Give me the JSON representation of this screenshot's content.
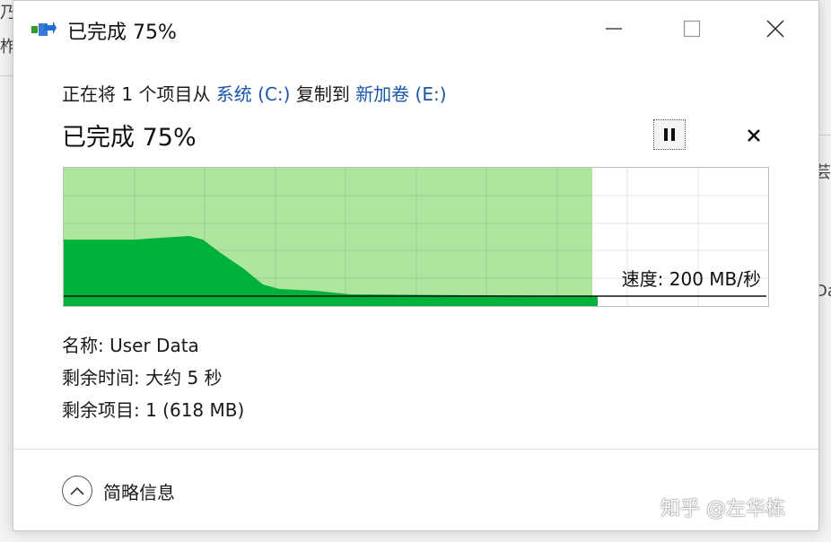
{
  "window": {
    "title": "已完成 75%"
  },
  "copy_line": {
    "prefix": "正在将 1 个项目从 ",
    "source": "系统 (C:)",
    "middle": " 复制到 ",
    "destination": "新加卷 (E:)"
  },
  "status": {
    "text": "已完成 75%",
    "percent": 75
  },
  "graph": {
    "speed_text": "速度: 200 MB/秒",
    "fill_color": "#00b23a",
    "progress_color": "#aee6a0"
  },
  "details": {
    "name": "名称: User Data",
    "time_remaining": "剩余时间: 大约 5 秒",
    "items_remaining": "剩余项目: 1 (618 MB)"
  },
  "footer": {
    "less_details_label": "简略信息",
    "watermark": "知乎 @左华栋"
  }
}
